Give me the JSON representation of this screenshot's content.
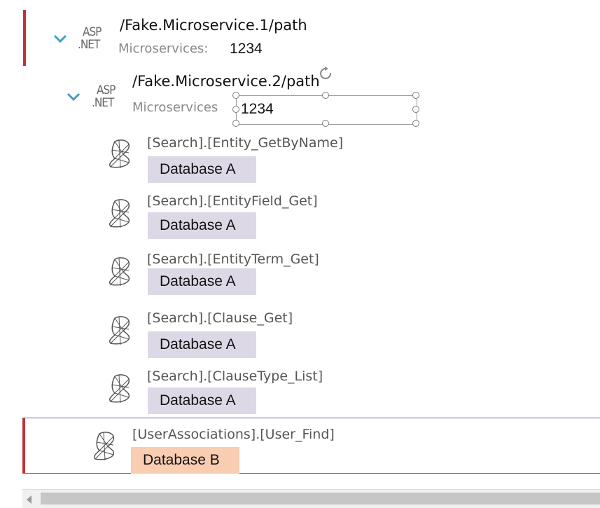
{
  "services": [
    {
      "path": "/Fake.Microservice.1/path",
      "subtitle": "Microservices:",
      "port": "1234",
      "icon_top": "ASP",
      "icon_bottom": ".NET"
    },
    {
      "path": "/Fake.Microservice.2/path",
      "subtitle": "Microservices",
      "port": "1234",
      "icon_top": "ASP",
      "icon_bottom": ".NET"
    }
  ],
  "procedures": [
    {
      "name": "[Search].[Entity_GetByName]",
      "database": "Database A"
    },
    {
      "name": "[Search].[EntityField_Get]",
      "database": "Database A"
    },
    {
      "name": "[Search].[EntityTerm_Get]",
      "database": "Database A"
    },
    {
      "name": "[Search].[Clause_Get]",
      "database": "Database A"
    },
    {
      "name": "[Search].[ClauseType_List]",
      "database": "Database A"
    },
    {
      "name": "[UserAssociations].[User_Find]",
      "database": "Database B"
    }
  ],
  "colors": {
    "accent_bar": "#c13238",
    "database_a": "#dcd8e6",
    "database_b": "#f8cdb1",
    "chevron": "#3fa0c4"
  },
  "icons": {
    "expand": "chevron-down-icon",
    "service": "aspnet-icon",
    "procedure": "sql-server-icon",
    "rotate": "rotate-handle-icon"
  }
}
